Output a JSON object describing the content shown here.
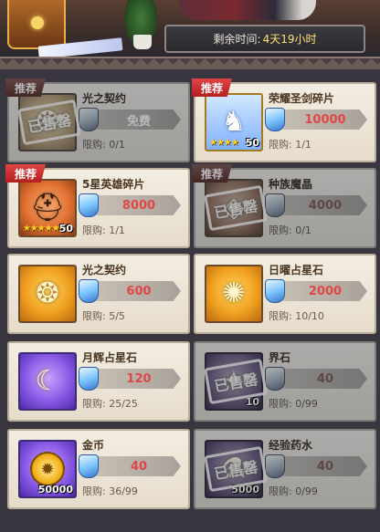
{
  "header": {
    "timer_label": "剩余时间:",
    "timer_value": "4天19小时"
  },
  "cards": [
    {
      "name": "光之契约",
      "price": "免费",
      "limit": "限购: 0/1",
      "tag": "推荐",
      "sold": true,
      "stamp": "已售罄",
      "icon": "contract-icon",
      "qty": ""
    },
    {
      "name": "荣耀圣剑碎片",
      "price": "10000",
      "limit": "限购: 1/1",
      "tag": "推荐",
      "sold": false,
      "stamp": "",
      "icon": "hero-shard-icon",
      "qty": "50",
      "stars": "★★★★"
    },
    {
      "name": "5星英雄碎片",
      "price": "8000",
      "limit": "限购: 1/1",
      "tag": "推荐",
      "sold": false,
      "stamp": "",
      "icon": "helmet-shard-icon",
      "qty": "50",
      "stars": "★★★★★"
    },
    {
      "name": "种族魔晶",
      "price": "4000",
      "limit": "限购: 0/1",
      "tag": "推荐",
      "sold": true,
      "stamp": "已售罄",
      "icon": "crystal-icon",
      "qty": ""
    },
    {
      "name": "光之契约",
      "price": "600",
      "limit": "限购: 5/5",
      "tag": "",
      "sold": false,
      "stamp": "",
      "icon": "contract-icon",
      "qty": ""
    },
    {
      "name": "日曜占星石",
      "price": "2000",
      "limit": "限购: 10/10",
      "tag": "",
      "sold": false,
      "stamp": "",
      "icon": "sun-stone-icon",
      "qty": ""
    },
    {
      "name": "月辉占星石",
      "price": "120",
      "limit": "限购: 25/25",
      "tag": "",
      "sold": false,
      "stamp": "",
      "icon": "moon-stone-icon",
      "qty": ""
    },
    {
      "name": "界石",
      "price": "40",
      "limit": "限购: 0/99",
      "tag": "",
      "sold": true,
      "stamp": "已售罄",
      "icon": "realm-stone-icon",
      "qty": "10"
    },
    {
      "name": "金币",
      "price": "40",
      "limit": "限购: 36/99",
      "tag": "",
      "sold": false,
      "stamp": "",
      "icon": "gold-coin-icon",
      "qty": "50000"
    },
    {
      "name": "经验药水",
      "price": "40",
      "limit": "限购: 0/99",
      "tag": "",
      "sold": true,
      "stamp": "已售罄",
      "icon": "exp-potion-icon",
      "qty": "5000"
    }
  ]
}
